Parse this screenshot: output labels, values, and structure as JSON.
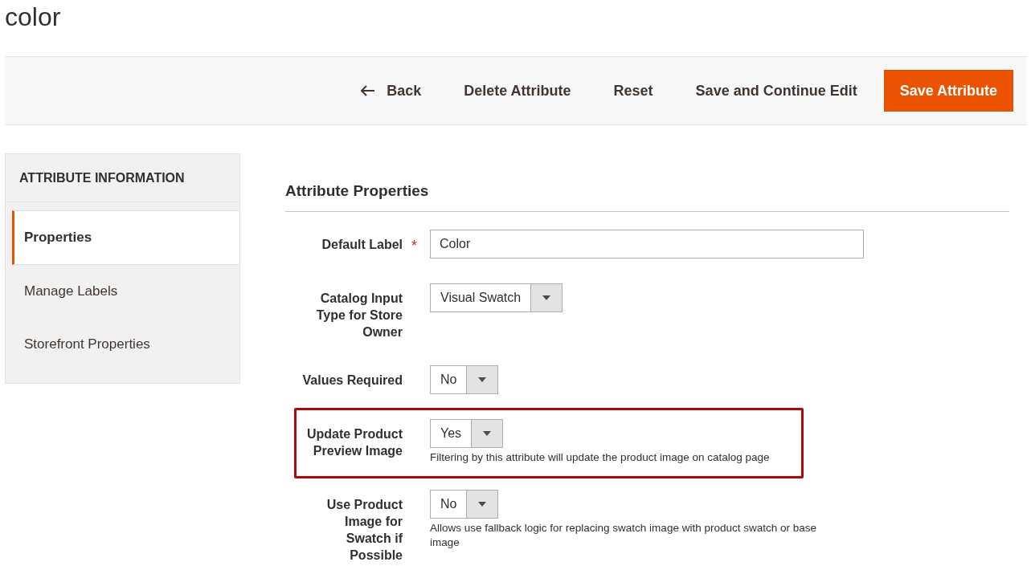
{
  "page_title": "color",
  "actions": [
    {
      "label": "Back",
      "kind": "back"
    },
    {
      "label": "Delete Attribute",
      "kind": "secondary"
    },
    {
      "label": "Reset",
      "kind": "secondary"
    },
    {
      "label": "Save and Continue Edit",
      "kind": "secondary"
    },
    {
      "label": "Save Attribute",
      "kind": "primary"
    }
  ],
  "sidebar": {
    "title": "ATTRIBUTE INFORMATION",
    "items": [
      {
        "label": "Properties",
        "selected": true
      },
      {
        "label": "Manage Labels",
        "selected": false
      },
      {
        "label": "Storefront Properties",
        "selected": false
      }
    ]
  },
  "section": {
    "title": "Attribute Properties",
    "fields": [
      {
        "label": "Default Label",
        "kind": "text",
        "value": "Color",
        "required_mark": "*"
      },
      {
        "label": "Catalog Input Type for Store Owner",
        "kind": "select",
        "value": "Visual Swatch"
      },
      {
        "label": "Values Required",
        "kind": "select",
        "value": "No"
      },
      {
        "label": "Update Product Preview Image",
        "kind": "select",
        "value": "Yes",
        "highlighted": true,
        "note": "Filtering by this attribute will update the product image on catalog page"
      },
      {
        "label": "Use Product Image for Swatch if Possible",
        "kind": "select",
        "value": "No",
        "note": "Allows use fallback logic for replacing swatch image with product swatch or base image"
      }
    ]
  }
}
